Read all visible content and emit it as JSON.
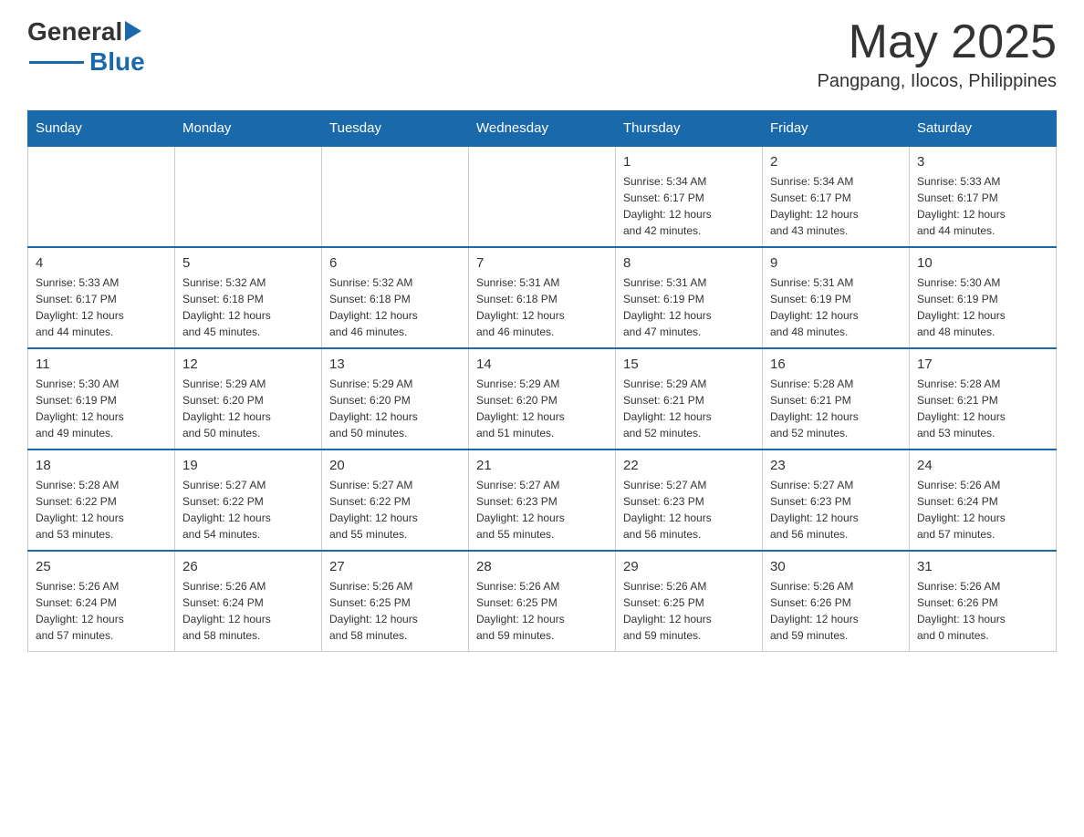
{
  "header": {
    "logo_general": "General",
    "logo_blue": "Blue",
    "month_year": "May 2025",
    "location": "Pangpang, Ilocos, Philippines"
  },
  "days_of_week": [
    "Sunday",
    "Monday",
    "Tuesday",
    "Wednesday",
    "Thursday",
    "Friday",
    "Saturday"
  ],
  "weeks": [
    [
      {
        "day": "",
        "info": ""
      },
      {
        "day": "",
        "info": ""
      },
      {
        "day": "",
        "info": ""
      },
      {
        "day": "",
        "info": ""
      },
      {
        "day": "1",
        "info": "Sunrise: 5:34 AM\nSunset: 6:17 PM\nDaylight: 12 hours\nand 42 minutes."
      },
      {
        "day": "2",
        "info": "Sunrise: 5:34 AM\nSunset: 6:17 PM\nDaylight: 12 hours\nand 43 minutes."
      },
      {
        "day": "3",
        "info": "Sunrise: 5:33 AM\nSunset: 6:17 PM\nDaylight: 12 hours\nand 44 minutes."
      }
    ],
    [
      {
        "day": "4",
        "info": "Sunrise: 5:33 AM\nSunset: 6:17 PM\nDaylight: 12 hours\nand 44 minutes."
      },
      {
        "day": "5",
        "info": "Sunrise: 5:32 AM\nSunset: 6:18 PM\nDaylight: 12 hours\nand 45 minutes."
      },
      {
        "day": "6",
        "info": "Sunrise: 5:32 AM\nSunset: 6:18 PM\nDaylight: 12 hours\nand 46 minutes."
      },
      {
        "day": "7",
        "info": "Sunrise: 5:31 AM\nSunset: 6:18 PM\nDaylight: 12 hours\nand 46 minutes."
      },
      {
        "day": "8",
        "info": "Sunrise: 5:31 AM\nSunset: 6:19 PM\nDaylight: 12 hours\nand 47 minutes."
      },
      {
        "day": "9",
        "info": "Sunrise: 5:31 AM\nSunset: 6:19 PM\nDaylight: 12 hours\nand 48 minutes."
      },
      {
        "day": "10",
        "info": "Sunrise: 5:30 AM\nSunset: 6:19 PM\nDaylight: 12 hours\nand 48 minutes."
      }
    ],
    [
      {
        "day": "11",
        "info": "Sunrise: 5:30 AM\nSunset: 6:19 PM\nDaylight: 12 hours\nand 49 minutes."
      },
      {
        "day": "12",
        "info": "Sunrise: 5:29 AM\nSunset: 6:20 PM\nDaylight: 12 hours\nand 50 minutes."
      },
      {
        "day": "13",
        "info": "Sunrise: 5:29 AM\nSunset: 6:20 PM\nDaylight: 12 hours\nand 50 minutes."
      },
      {
        "day": "14",
        "info": "Sunrise: 5:29 AM\nSunset: 6:20 PM\nDaylight: 12 hours\nand 51 minutes."
      },
      {
        "day": "15",
        "info": "Sunrise: 5:29 AM\nSunset: 6:21 PM\nDaylight: 12 hours\nand 52 minutes."
      },
      {
        "day": "16",
        "info": "Sunrise: 5:28 AM\nSunset: 6:21 PM\nDaylight: 12 hours\nand 52 minutes."
      },
      {
        "day": "17",
        "info": "Sunrise: 5:28 AM\nSunset: 6:21 PM\nDaylight: 12 hours\nand 53 minutes."
      }
    ],
    [
      {
        "day": "18",
        "info": "Sunrise: 5:28 AM\nSunset: 6:22 PM\nDaylight: 12 hours\nand 53 minutes."
      },
      {
        "day": "19",
        "info": "Sunrise: 5:27 AM\nSunset: 6:22 PM\nDaylight: 12 hours\nand 54 minutes."
      },
      {
        "day": "20",
        "info": "Sunrise: 5:27 AM\nSunset: 6:22 PM\nDaylight: 12 hours\nand 55 minutes."
      },
      {
        "day": "21",
        "info": "Sunrise: 5:27 AM\nSunset: 6:23 PM\nDaylight: 12 hours\nand 55 minutes."
      },
      {
        "day": "22",
        "info": "Sunrise: 5:27 AM\nSunset: 6:23 PM\nDaylight: 12 hours\nand 56 minutes."
      },
      {
        "day": "23",
        "info": "Sunrise: 5:27 AM\nSunset: 6:23 PM\nDaylight: 12 hours\nand 56 minutes."
      },
      {
        "day": "24",
        "info": "Sunrise: 5:26 AM\nSunset: 6:24 PM\nDaylight: 12 hours\nand 57 minutes."
      }
    ],
    [
      {
        "day": "25",
        "info": "Sunrise: 5:26 AM\nSunset: 6:24 PM\nDaylight: 12 hours\nand 57 minutes."
      },
      {
        "day": "26",
        "info": "Sunrise: 5:26 AM\nSunset: 6:24 PM\nDaylight: 12 hours\nand 58 minutes."
      },
      {
        "day": "27",
        "info": "Sunrise: 5:26 AM\nSunset: 6:25 PM\nDaylight: 12 hours\nand 58 minutes."
      },
      {
        "day": "28",
        "info": "Sunrise: 5:26 AM\nSunset: 6:25 PM\nDaylight: 12 hours\nand 59 minutes."
      },
      {
        "day": "29",
        "info": "Sunrise: 5:26 AM\nSunset: 6:25 PM\nDaylight: 12 hours\nand 59 minutes."
      },
      {
        "day": "30",
        "info": "Sunrise: 5:26 AM\nSunset: 6:26 PM\nDaylight: 12 hours\nand 59 minutes."
      },
      {
        "day": "31",
        "info": "Sunrise: 5:26 AM\nSunset: 6:26 PM\nDaylight: 13 hours\nand 0 minutes."
      }
    ]
  ]
}
